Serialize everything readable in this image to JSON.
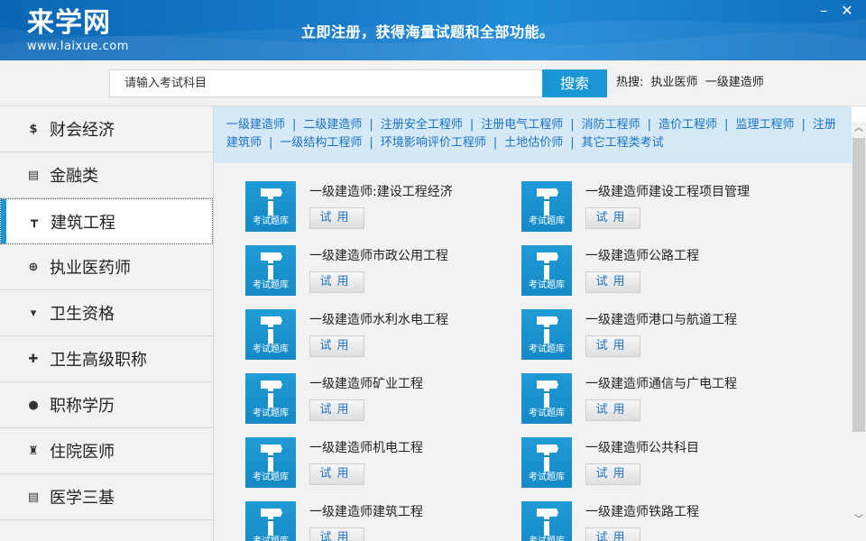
{
  "header": {
    "logo_main": "来学网",
    "logo_sub": "www.laixue.com",
    "slogan": "立即注册，获得海量试题和全部功能。",
    "minimize": "–",
    "close": "✕"
  },
  "search": {
    "placeholder": "请输入考试科目",
    "button": "搜索",
    "hot_label": "热搜:",
    "hot_items": [
      "执业医师",
      "一级建造师"
    ]
  },
  "sidebar": {
    "items": [
      {
        "label": "财会经济",
        "icon": "dollar-icon",
        "glyph": "$"
      },
      {
        "label": "金融类",
        "icon": "clipboard-icon",
        "glyph": "▤"
      },
      {
        "label": "建筑工程",
        "icon": "sign-post-icon",
        "glyph": "┳",
        "active": true
      },
      {
        "label": "执业医药师",
        "icon": "medical-kit-icon",
        "glyph": "⊕"
      },
      {
        "label": "卫生资格",
        "icon": "mask-icon",
        "glyph": "▾"
      },
      {
        "label": "卫生高级职称",
        "icon": "plus-icon",
        "glyph": "✚"
      },
      {
        "label": "职称学历",
        "icon": "user-icon",
        "glyph": "●"
      },
      {
        "label": "住院医师",
        "icon": "doctor-icon",
        "glyph": "♜"
      },
      {
        "label": "医学三基",
        "icon": "clipboard-icon",
        "glyph": "▤"
      }
    ]
  },
  "categories": [
    "一级建造师",
    "二级建造师",
    "注册安全工程师",
    "注册电气工程师",
    "消防工程师",
    "造价工程师",
    "监理工程师",
    "注册建筑师",
    "一级结构工程师",
    "环境影响评价工程师",
    "土地估价师",
    "其它工程类考试"
  ],
  "cards": [
    {
      "title": "一级建造师:建设工程经济",
      "thumb_label": "考试题库",
      "button": "试用"
    },
    {
      "title": "一级建造师建设工程项目管理",
      "thumb_label": "考试题库",
      "button": "试用"
    },
    {
      "title": "一级建造师市政公用工程",
      "thumb_label": "考试题库",
      "button": "试用"
    },
    {
      "title": "一级建造师公路工程",
      "thumb_label": "考试题库",
      "button": "试用"
    },
    {
      "title": "一级建造师水利水电工程",
      "thumb_label": "考试题库",
      "button": "试用"
    },
    {
      "title": "一级建造师港口与航道工程",
      "thumb_label": "考试题库",
      "button": "试用"
    },
    {
      "title": "一级建造师矿业工程",
      "thumb_label": "考试题库",
      "button": "试用"
    },
    {
      "title": "一级建造师通信与广电工程",
      "thumb_label": "考试题库",
      "button": "试用"
    },
    {
      "title": "一级建造师机电工程",
      "thumb_label": "考试题库",
      "button": "试用"
    },
    {
      "title": "一级建造师公共科目",
      "thumb_label": "考试题库",
      "button": "试用"
    },
    {
      "title": "一级建造师建筑工程",
      "thumb_label": "考试题库",
      "button": "试用"
    },
    {
      "title": "一级建造师铁路工程",
      "thumb_label": "考试题库",
      "button": "试用"
    }
  ],
  "colors": {
    "accent": "#1996d4",
    "header": "#0f6fbf",
    "link": "#1a72c4",
    "category_bar": "#d4e8f5"
  }
}
